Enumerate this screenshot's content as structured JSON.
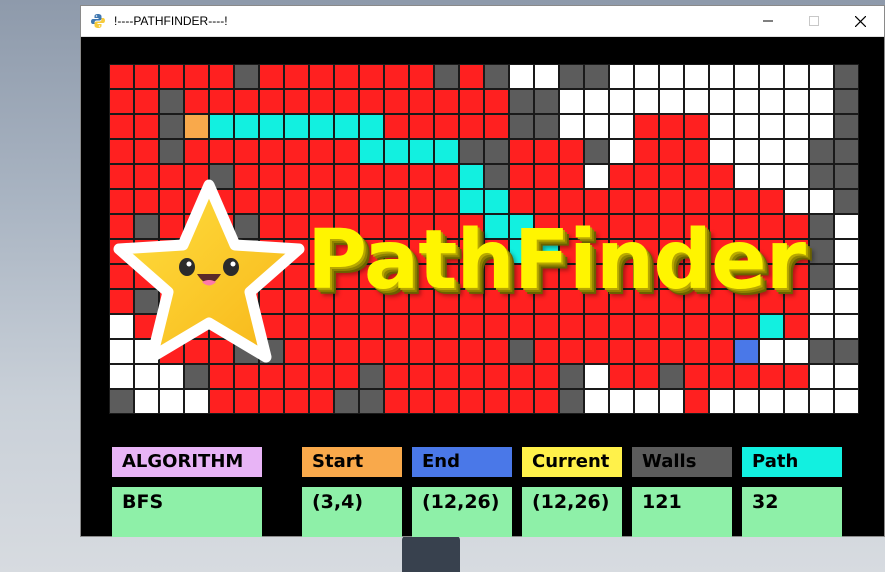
{
  "window": {
    "title": "!----PATHFINDER----!",
    "buttons": [
      "minimize",
      "maximize",
      "close"
    ]
  },
  "logo": {
    "text": "PathFinder",
    "mascot": "smiling-star"
  },
  "grid": {
    "cols": 30,
    "rows": 14,
    "legend": {
      "R": "#ff2020",
      "G": "#5c5c5c",
      "W": "#ffffff",
      "C": "#12f0e0",
      "O": "#f9a94b",
      "B": "#4a78e8",
      "K": "#000000"
    },
    "cells": [
      "RRRRRGRRRRRRRGRGWWGGWWWWWWWWWG",
      "RRGRRRRRRRRRRRRRGGWWWWWWWWWWWG",
      "RRGOCCCCCCCRRRRRGGWWWRRRWWWWWG",
      "RRGRRRRRRRCCCCGGRRRGWRRRWWWWGG",
      "RRRRGRRRRRRRRRCGRRRWRRRRRWWWGG",
      "RRRRRRRRRRRRRRCCRRRRRRRRRRRWWG",
      "RGRRRGRRRRRRRRRCCRRRRRRRRRRRGW",
      "RRRRGGRRRRRRRRRRCCRRRRRRRRRRGW",
      "RRRRRRRRRRRRRRRRRRRRRRRRRRRRGW",
      "RGRRRRRRRRRRRRRRRRRRRRRRRRRRWW",
      "WRRRRRRRRRRRRRRRRRRRRRRRRRCRWW",
      "WWRRRGGRRRRRRRRRGRRRRRRRRBWWGG",
      "WWWGRRRRRRGRRRRRRRGWRRGRRRRRWW",
      "GWWWRRRRRGGRRRRRRRGWWWWRWWWWWW"
    ]
  },
  "info": {
    "algorithm": {
      "label": "ALGORITHM",
      "value": "BFS",
      "label_color": "#e8b4f6"
    },
    "start": {
      "label": "Start",
      "value": "(3,4)",
      "label_color": "#f9a94b"
    },
    "end": {
      "label": "End",
      "value": "(12,26)",
      "label_color": "#4a78e8"
    },
    "current": {
      "label": "Current",
      "value": "(12,26)",
      "label_color": "#fff14a"
    },
    "walls": {
      "label": "Walls",
      "value": "121",
      "label_color": "#5c5c5c"
    },
    "path": {
      "label": "Path",
      "value": "32",
      "label_color": "#12f0e0"
    },
    "value_color": "#8ef0a8"
  }
}
